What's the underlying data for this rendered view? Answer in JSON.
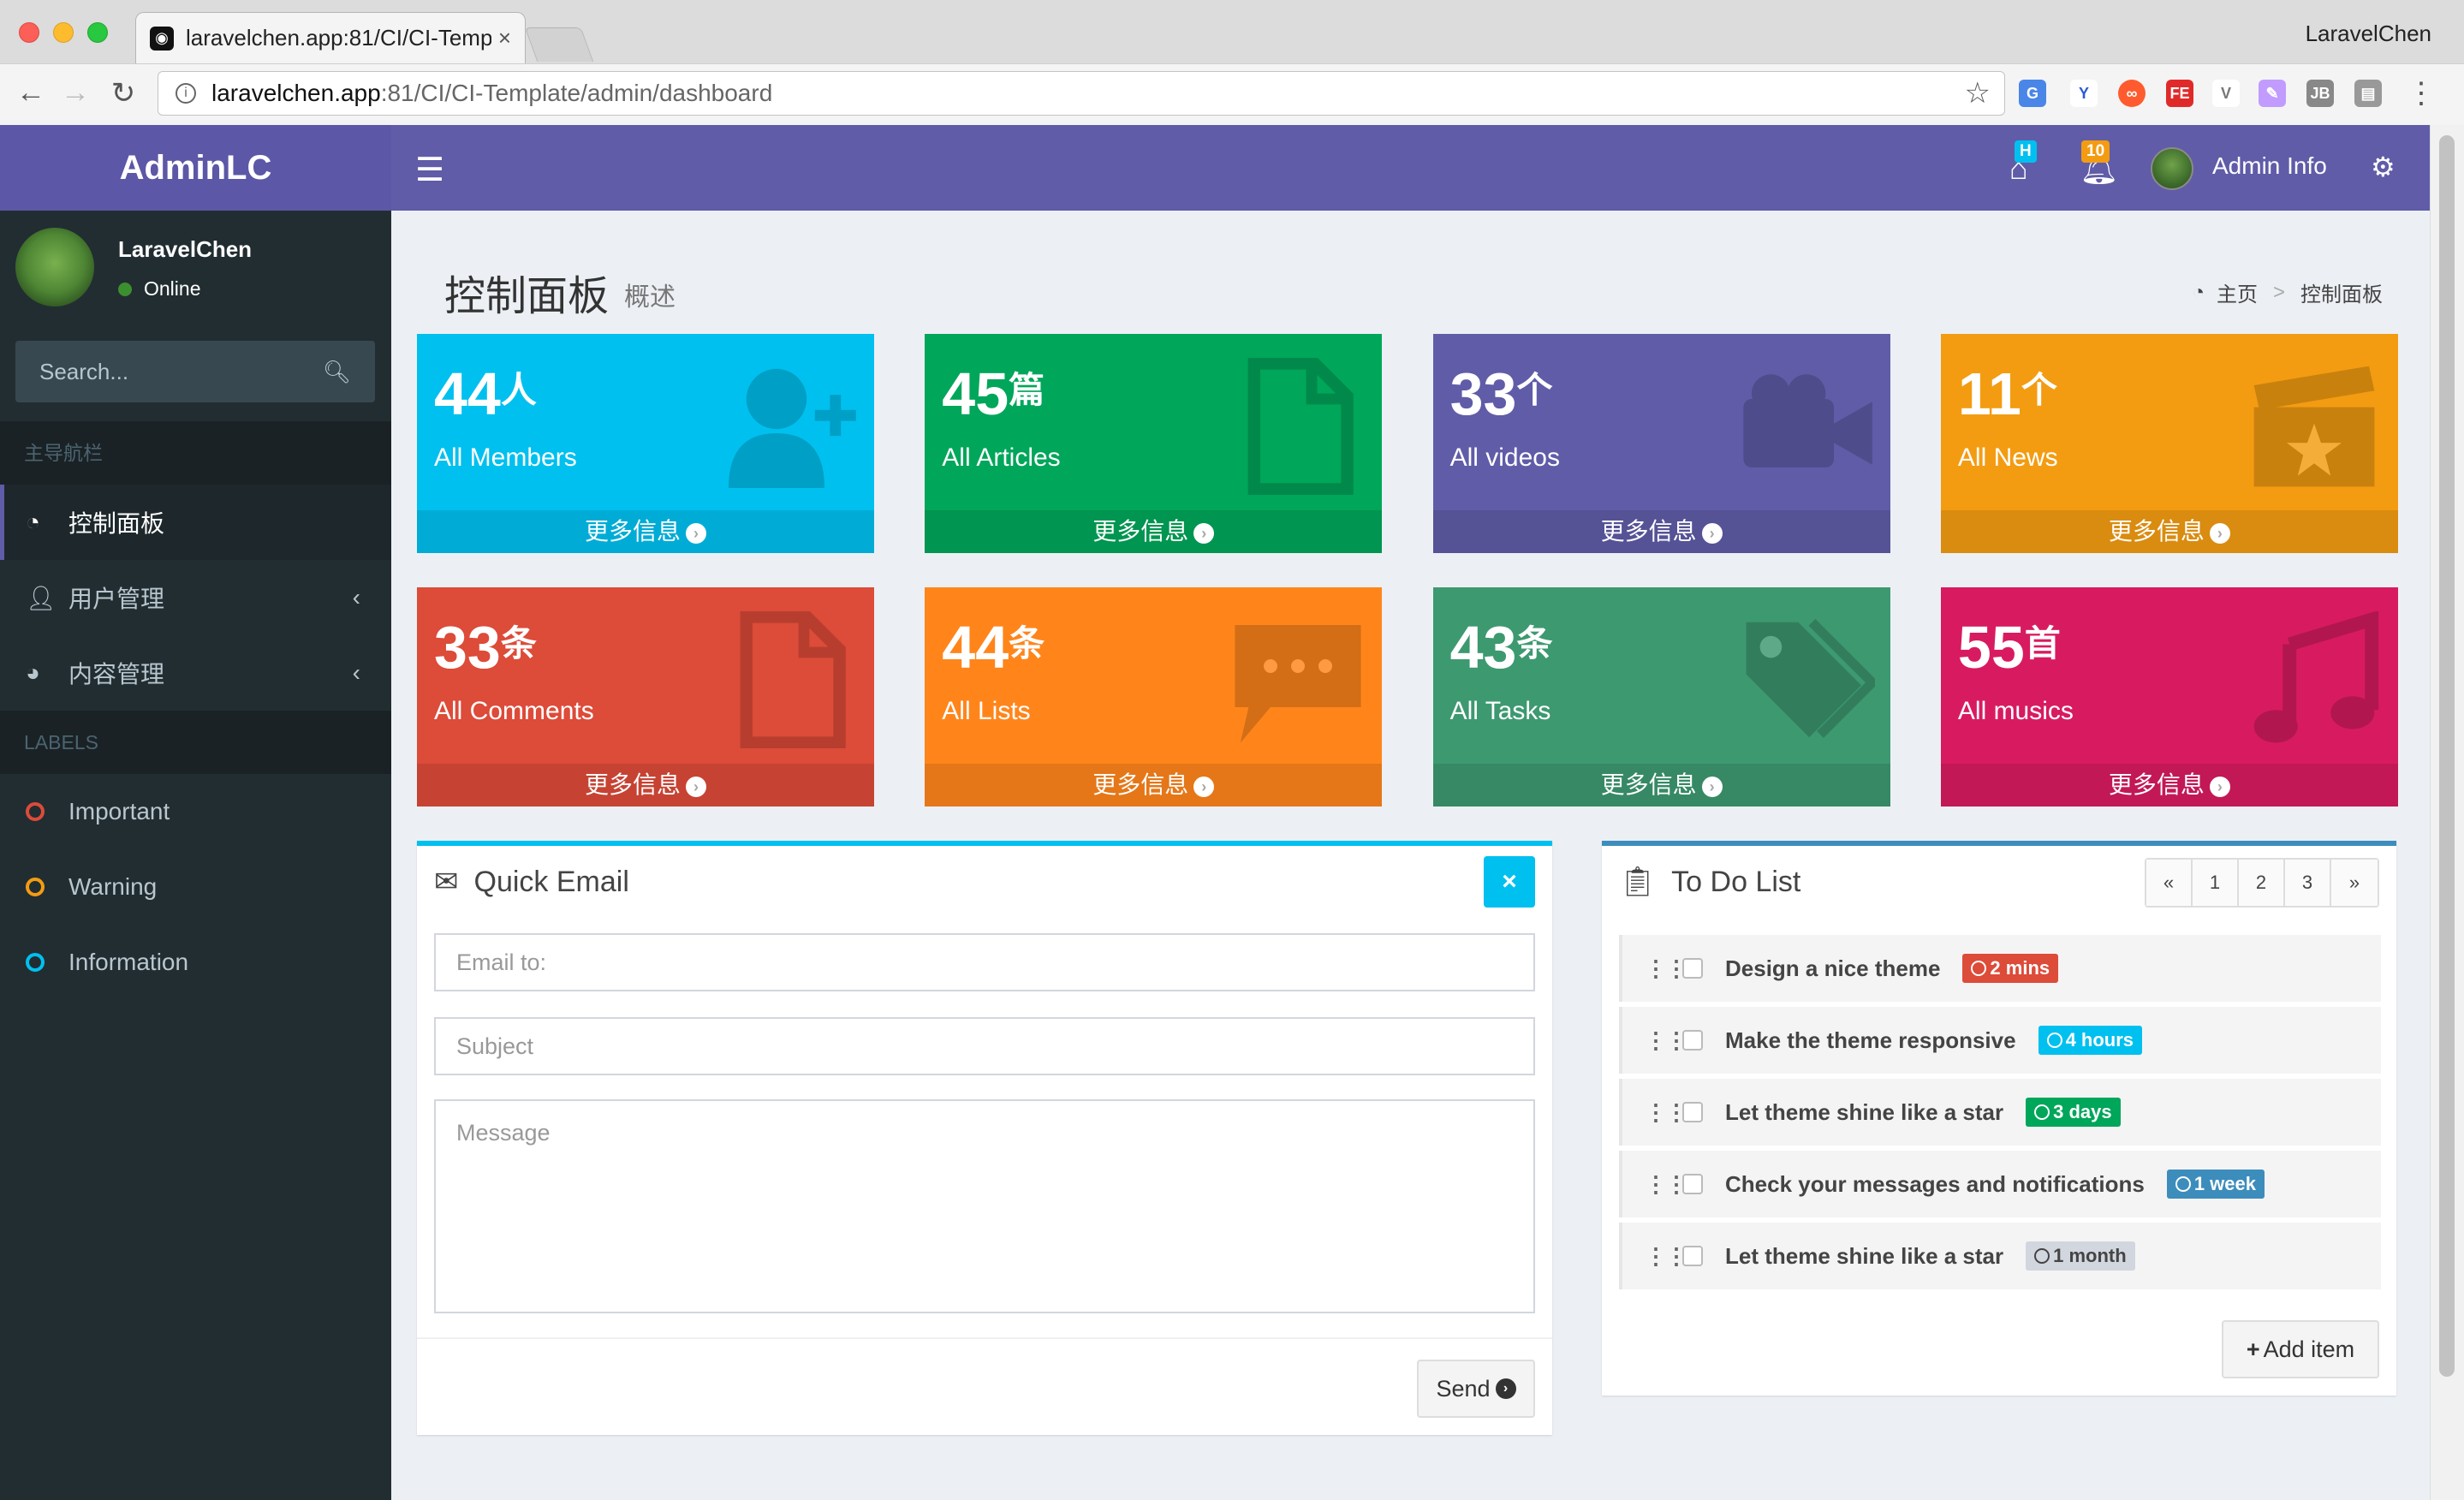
{
  "browser": {
    "tab_title": "laravelchen.app:81/CI/CI-Temp",
    "tab_close": "×",
    "profile_name": "LaravelChen",
    "url_host": "laravelchen.app",
    "url_path": ":81/CI/CI-Template/admin/dashboard"
  },
  "header": {
    "logo": "AdminLC",
    "home_badge": "H",
    "notification_badge": "10",
    "admin_label": "Admin Info"
  },
  "sidebar": {
    "user_name": "LaravelChen",
    "user_status": "Online",
    "search_placeholder": "Search...",
    "nav_header": "主导航栏",
    "nav_items": [
      {
        "label": "控制面板",
        "icon": "dashboard-icon"
      },
      {
        "label": "用户管理",
        "icon": "user-icon"
      },
      {
        "label": "内容管理",
        "icon": "pie-chart-icon"
      }
    ],
    "labels_header": "LABELS",
    "labels": [
      {
        "label": "Important",
        "color": "#dd4b39"
      },
      {
        "label": "Warning",
        "color": "#f39c12"
      },
      {
        "label": "Information",
        "color": "#00c0ef"
      }
    ]
  },
  "page": {
    "title": "控制面板",
    "subtitle": "概述",
    "breadcrumb_home": "主页",
    "breadcrumb_current": "控制面板"
  },
  "stats": [
    {
      "number": "44",
      "unit": "人",
      "label": "All Members",
      "more": "更多信息",
      "color": "#00c0ef",
      "icon": "user-plus-icon"
    },
    {
      "number": "45",
      "unit": "篇",
      "label": "All Articles",
      "more": "更多信息",
      "color": "#00a65a",
      "icon": "file-icon"
    },
    {
      "number": "33",
      "unit": "个",
      "label": "All videos",
      "more": "更多信息",
      "color": "#605ca8",
      "icon": "video-camera-icon"
    },
    {
      "number": "11",
      "unit": "个",
      "label": "All News",
      "more": "更多信息",
      "color": "#f39c12",
      "icon": "clapperboard-icon"
    },
    {
      "number": "33",
      "unit": "条",
      "label": "All Comments",
      "more": "更多信息",
      "color": "#dd4b39",
      "icon": "file-outline-icon"
    },
    {
      "number": "44",
      "unit": "条",
      "label": "All Lists",
      "more": "更多信息",
      "color": "#ff851b",
      "icon": "comment-icon"
    },
    {
      "number": "43",
      "unit": "条",
      "label": "All Tasks",
      "more": "更多信息",
      "color": "#3d9970",
      "icon": "tags-icon"
    },
    {
      "number": "55",
      "unit": "首",
      "label": "All musics",
      "more": "更多信息",
      "color": "#d81b60",
      "icon": "music-icon"
    }
  ],
  "quick_email": {
    "title": "Quick Email",
    "close": "×",
    "email_placeholder": "Email to:",
    "subject_placeholder": "Subject",
    "message_placeholder": "Message",
    "send_label": "Send"
  },
  "todo": {
    "title": "To Do List",
    "pager": [
      "«",
      "1",
      "2",
      "3",
      "»"
    ],
    "items": [
      {
        "text": "Design a nice theme",
        "time": "2 mins",
        "color": "#dd4b39"
      },
      {
        "text": "Make the theme responsive",
        "time": "4 hours",
        "color": "#00c0ef"
      },
      {
        "text": "Let theme shine like a star",
        "time": "3 days",
        "color": "#00a65a"
      },
      {
        "text": "Check your messages and notifications",
        "time": "1 week",
        "color": "#3c8dbc"
      },
      {
        "text": "Let theme shine like a star",
        "time": "1 month",
        "color": "#d2d6de"
      }
    ],
    "add_label": "Add item"
  }
}
